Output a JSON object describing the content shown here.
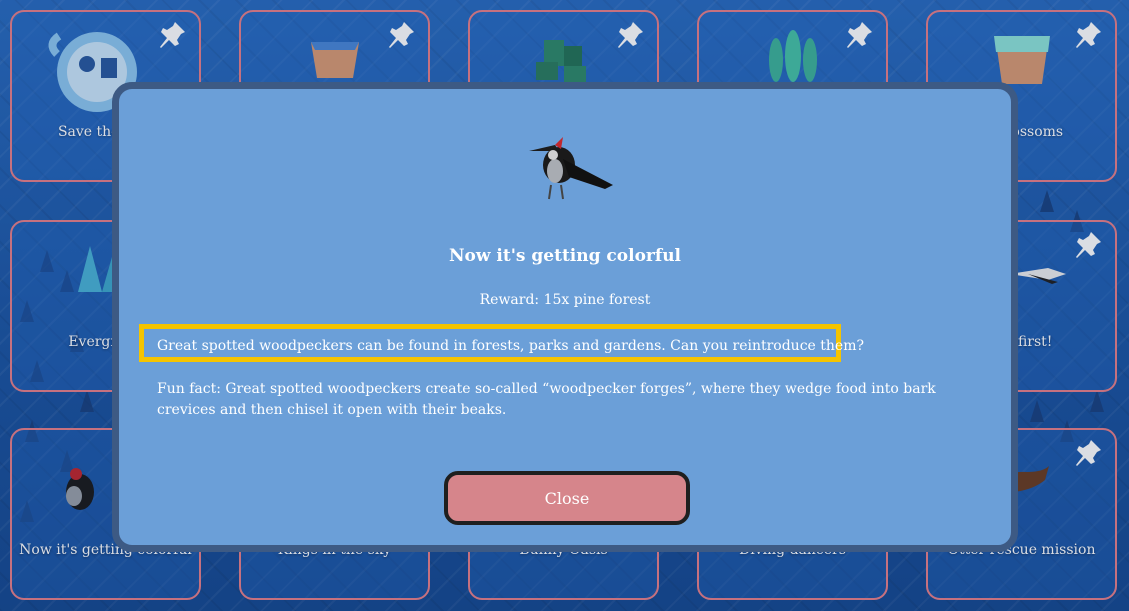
{
  "cards": [
    {
      "title": "Save the drin",
      "thumb": "water-drop-icon"
    },
    {
      "title": "",
      "thumb": "water-tile-icon"
    },
    {
      "title": "",
      "thumb": "tree-cluster-icon"
    },
    {
      "title": "",
      "thumb": "cypress-trees-icon"
    },
    {
      "title": "of blossoms",
      "thumb": "ice-tile-icon"
    },
    {
      "title": "Evergreen",
      "thumb": "pine-trees-icon"
    },
    {
      "title": "the first!",
      "thumb": "stork-icon"
    },
    {
      "title": "Now it's getting colorful",
      "thumb": "woodpecker-icon"
    },
    {
      "title": "Kings in the sky",
      "thumb": ""
    },
    {
      "title": "Bunny Oasis",
      "thumb": ""
    },
    {
      "title": "Diving dancers",
      "thumb": ""
    },
    {
      "title": "Otter rescue mission",
      "thumb": "otter-icon"
    }
  ],
  "modal": {
    "title": "Now it's getting colorful",
    "reward": "Reward:  15x pine forest",
    "quest": "Great spotted woodpeckers can be found in forests, parks and gardens. Can you reintroduce them?",
    "funfact": "Fun fact: Great spotted woodpeckers create so-called “woodpecker forges”, where they wedge food into bark crevices and then chisel it open with their beaks.",
    "close_label": "Close"
  },
  "colors": {
    "modal_bg": "#6b9fd8",
    "modal_border": "#3d5a84",
    "highlight": "#f5c400",
    "close_button": "#d6858b",
    "card_border": "#e8808a"
  }
}
